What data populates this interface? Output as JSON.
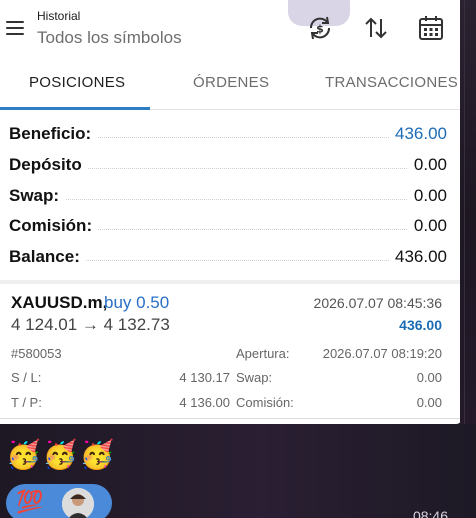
{
  "header": {
    "title": "Historial",
    "subtitle": "Todos los símbolos",
    "icons": [
      "menu-icon",
      "sync-currency-icon",
      "sort-arrows-icon",
      "calendar-icon"
    ]
  },
  "tabs": [
    {
      "label": "POSICIONES",
      "active": true
    },
    {
      "label": "ÓRDENES",
      "active": false
    },
    {
      "label": "TRANSACCIONES",
      "active": false
    }
  ],
  "summary": [
    {
      "label": "Beneficio:",
      "value": "436.00",
      "highlight": true
    },
    {
      "label": "Depósito",
      "value": "0.00",
      "highlight": false
    },
    {
      "label": "Swap:",
      "value": "0.00",
      "highlight": false
    },
    {
      "label": "Comisión:",
      "value": "0.00",
      "highlight": false
    },
    {
      "label": "Balance:",
      "value": "436.00",
      "highlight": false
    }
  ],
  "deal": {
    "symbol": "XAUUSD.m,",
    "action": "buy 0.50",
    "close_time": "2026.07.07 08:45:36",
    "prices": "4 124.01 → 4 132.73",
    "profit": "436.00",
    "ticket": "#580053",
    "open_label": "Apertura:",
    "open_time": "2026.07.07 08:19:20",
    "sl_label": "S / L:",
    "sl_value": "4 130.17",
    "swap_label": "Swap:",
    "swap_value": "0.00",
    "tp_label": "T / P:",
    "tp_value": "4 136.00",
    "commission_label": "Comisión:",
    "commission_value": "0.00"
  },
  "chat": {
    "emojis": "🥳🥳🥳",
    "reaction": "💯",
    "time": "08:46"
  },
  "colors": {
    "accent_blue": "#2f7ec4",
    "profit_blue": "#1c6cb5",
    "action_blue": "#2a6fc7",
    "reaction_pill": "#4a8ad9"
  }
}
